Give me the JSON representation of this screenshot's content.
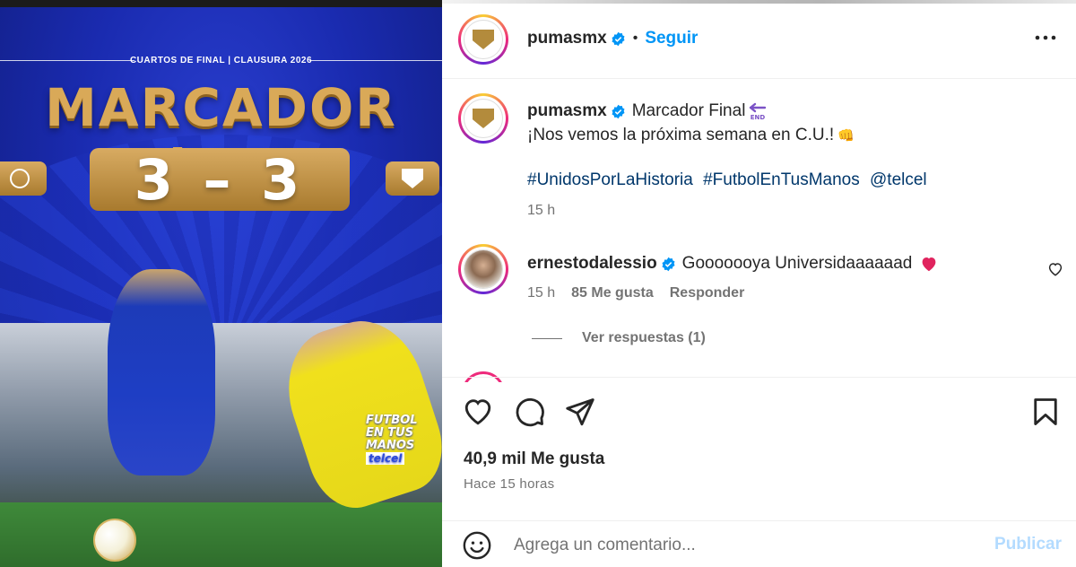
{
  "media": {
    "subtitle": "CUARTOS DE FINAL | CLAUSURA 2026",
    "headline": "MARCADOR FiNAL",
    "score": "3 – 3",
    "campaign": {
      "line1": "FUTBOL",
      "line2": "EN TUS",
      "line3": "MANOS",
      "brand": "telcel"
    }
  },
  "header": {
    "username": "pumasmx",
    "verified_icon": "verified-badge-icon",
    "separator": "•",
    "follow_label": "Seguir",
    "more_icon": "more-options-icon"
  },
  "caption": {
    "username": "pumasmx",
    "text": "Marcador Final",
    "end_icon": "end-arrow-emoji",
    "line2": "¡Nos vemos la próxima semana en C.U.!",
    "line2_emoji": "👊",
    "hashtags": [
      "#UnidosPorLaHistoria",
      "#FutbolEnTusManos",
      "@telcel"
    ],
    "time": "15 h"
  },
  "comment": {
    "username": "ernestodalessio",
    "text": "Gooooooya Universidaaaaaad",
    "heart_emoji": "red-heart-emoji",
    "time": "15 h",
    "likes": "85 Me gusta",
    "reply_label": "Responder",
    "view_replies": "Ver respuestas (1)"
  },
  "actions": {
    "like_icon": "heart-icon",
    "comment_icon": "comment-icon",
    "share_icon": "share-icon",
    "save_icon": "bookmark-icon"
  },
  "stats": {
    "likes": "40,9 mil Me gusta",
    "ago": "Hace 15 horas"
  },
  "composer": {
    "placeholder": "Agrega un comentario...",
    "post_label": "Publicar",
    "emoji_icon": "emoji-icon"
  },
  "colors": {
    "accent": "#0095f6",
    "link": "#00376b",
    "muted": "#737373",
    "post_disabled": "#b3dbff",
    "media_blue": "#1a2bb0",
    "gold": "#d9a958"
  }
}
